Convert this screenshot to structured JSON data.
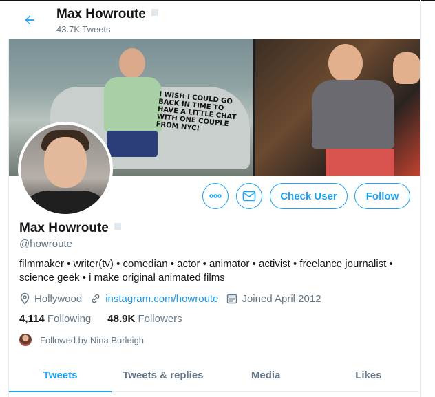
{
  "header": {
    "title": "Max Howroute",
    "tweet_count": "43.7K Tweets",
    "back_icon": "arrow-left-icon"
  },
  "banner": {
    "sign_text": "I WISH I COULD GO BACK IN TIME TO HAVE A LITTLE CHAT WITH ONE COUPLE FROM NYC!"
  },
  "actions": {
    "more_icon": "more-horizontal-icon",
    "message_icon": "envelope-icon",
    "check_user_label": "Check User",
    "follow_label": "Follow"
  },
  "profile": {
    "name": "Max Howroute",
    "handle": "@howroute",
    "bio": "filmmaker • writer(tv) • comedian • actor • animator • activist • freelance journalist • science geek • i make original animated films",
    "location": "Hollywood",
    "website": "instagram.com/howroute",
    "joined": "Joined April 2012"
  },
  "stats": {
    "following_count": "4,114",
    "following_label": "Following",
    "followers_count": "48.9K",
    "followers_label": "Followers"
  },
  "followed_by": "Followed by Nina Burleigh",
  "tabs": [
    {
      "label": "Tweets",
      "active": true
    },
    {
      "label": "Tweets & replies",
      "active": false
    },
    {
      "label": "Media",
      "active": false
    },
    {
      "label": "Likes",
      "active": false
    }
  ],
  "colors": {
    "accent": "#1da1f2",
    "text": "#14171a",
    "secondary": "#657786",
    "link": "#1b95e0"
  }
}
